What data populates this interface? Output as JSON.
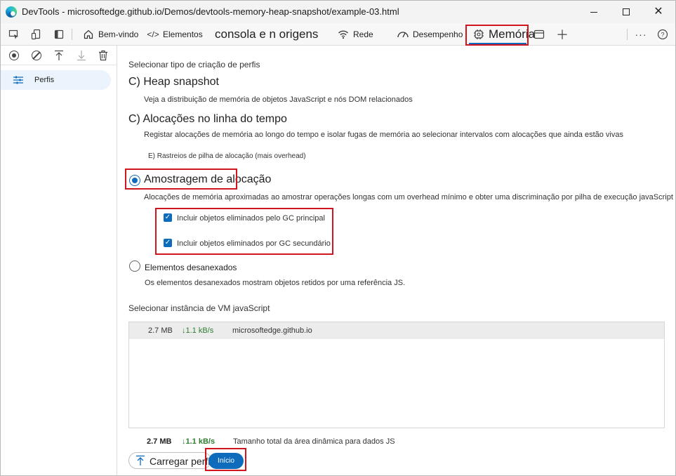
{
  "window": {
    "title": "DevTools - microsoftedge.github.io/Demos/devtools-memory-heap-snapshot/example-03.html"
  },
  "toolbar": {
    "tabs": [
      {
        "label": "Bem-vindo",
        "icon": "home-icon"
      },
      {
        "label": "Elementos",
        "icon": "code-icon"
      },
      {
        "label": "consola e n origens",
        "icon": ""
      },
      {
        "label": "Rede",
        "icon": "wifi-icon"
      },
      {
        "label": "Desempenho",
        "icon": "gauge-icon"
      },
      {
        "label": "Memória",
        "icon": "chip-icon"
      }
    ],
    "active_tab": "Memória"
  },
  "sidebar": {
    "item_label": "Perfis"
  },
  "profiles": {
    "section_title": "Selecionar tipo de criação de perfis",
    "options": [
      {
        "title": "C) Heap snapshot",
        "description": "Veja a distribuição de memória de objetos JavaScript e nós DOM relacionados"
      },
      {
        "title": "C) Alocações no linha do tempo",
        "description": "Registar alocações de memória ao longo do tempo e isolar fugas de memória ao selecionar intervalos com alocações que ainda estão vivas",
        "sub_option": "E)   Rastreios de pilha de alocação (mais overhead)"
      },
      {
        "title": "Amostragem de alocação",
        "description": "Alocações de memória aproximadas ao amostrar operações longas com um overhead mínimo e obter uma discriminação por pilha de execução javaScript",
        "selected": true,
        "checkboxes": [
          {
            "label": "Incluir objetos eliminados pelo GC principal",
            "checked": true
          },
          {
            "label": "Incluir objetos eliminados por GC secundário",
            "checked": true
          }
        ]
      },
      {
        "title": "Elementos desanexados",
        "description": "Os elementos desanexados mostram objetos retidos por uma referência JS."
      }
    ]
  },
  "vm": {
    "section_title": "Selecionar instância de VM javaScript",
    "rows": [
      {
        "size": "2.7 MB",
        "rate": "↓1.1 kB/s",
        "name": "microsoftedge.github.io"
      }
    ],
    "total": {
      "size": "2.7 MB",
      "rate": "↓1.1 kB/s",
      "label": "Tamanho total da área dinâmica para dados JS"
    }
  },
  "actions": {
    "load_label": "Carregar perfil",
    "start_label": "Início"
  },
  "colors": {
    "accent": "#0f6cbd",
    "highlight": "#d0151f"
  }
}
